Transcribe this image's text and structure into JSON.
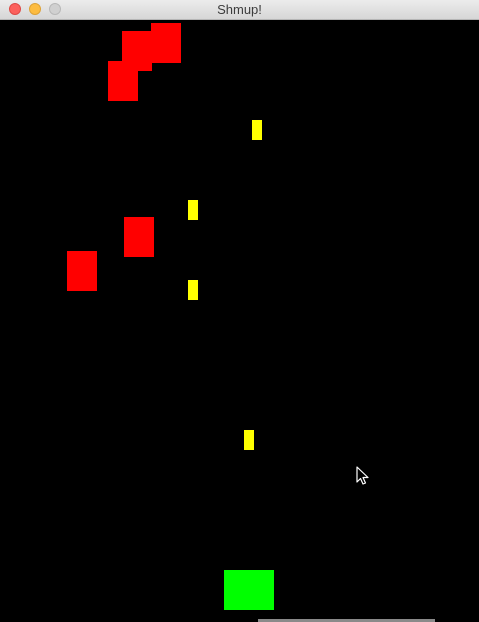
{
  "window": {
    "title": "Shmup!"
  },
  "colors": {
    "background": "#000000",
    "mob": "#ff0000",
    "bullet": "#ffff00",
    "player": "#00ff00"
  },
  "icons": {
    "close": "close-icon",
    "minimize": "minimize-icon",
    "zoom": "zoom-icon",
    "cursor": "mouse-cursor-icon"
  }
}
